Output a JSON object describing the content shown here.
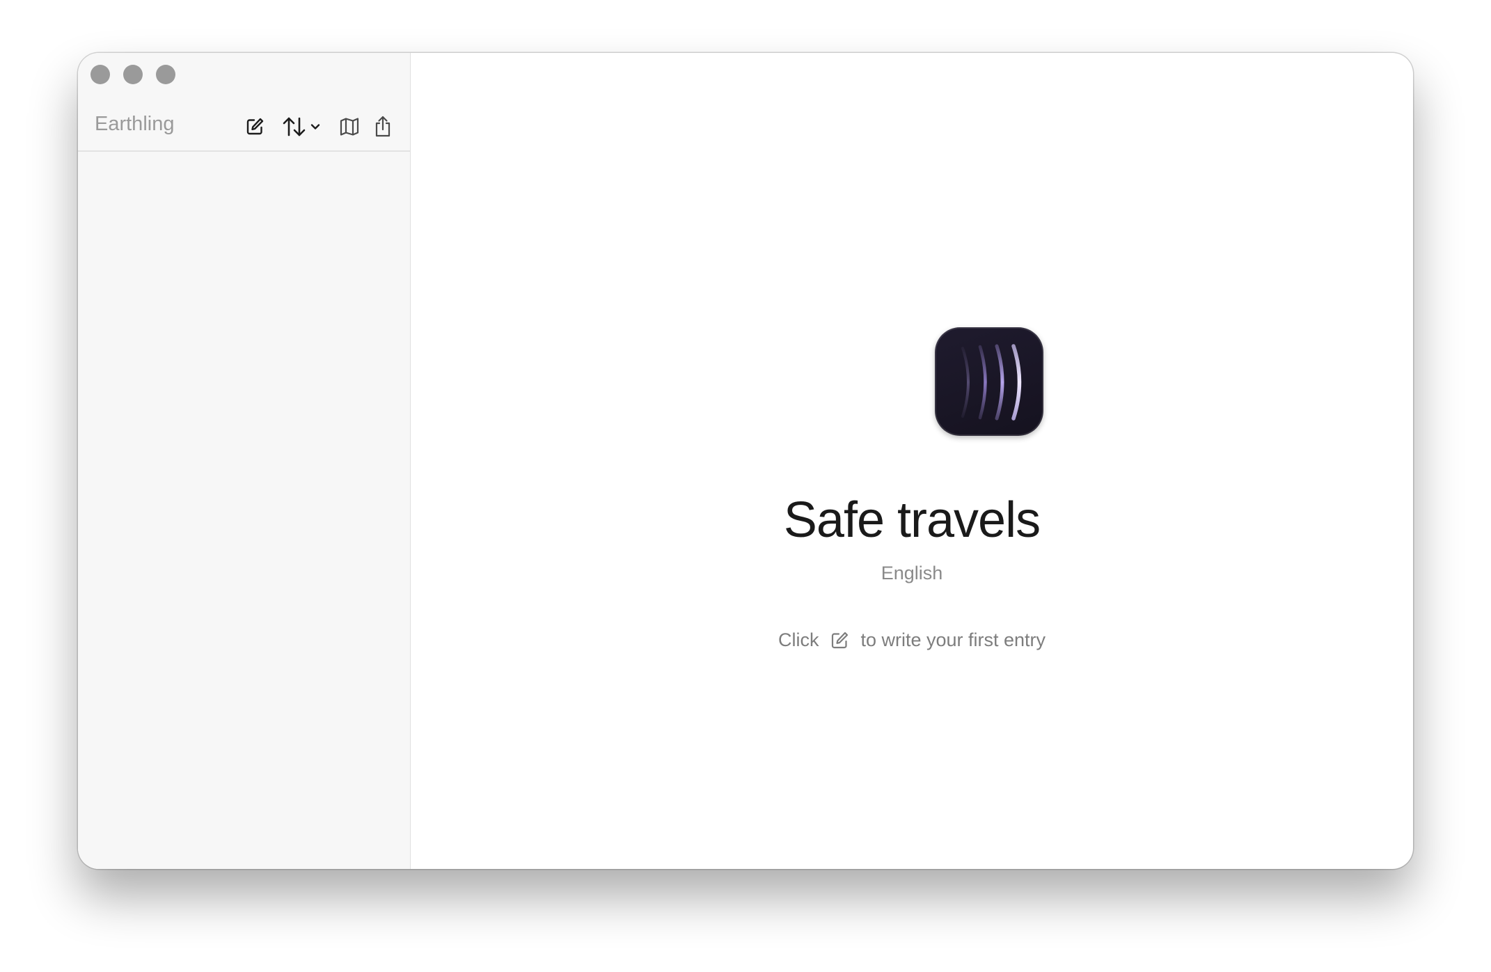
{
  "window": {
    "traffic_lights": [
      "close",
      "minimize",
      "zoom"
    ]
  },
  "sidebar": {
    "app_name": "Earthling",
    "toolbar": {
      "new_entry_icon": "compose-icon",
      "sort_icon": "sort-arrows-icon",
      "sort_dropdown_icon": "chevron-down-icon",
      "map_icon": "map-icon",
      "share_icon": "share-icon"
    }
  },
  "main": {
    "app_icon": "earthling-app-icon",
    "title": "Safe travels",
    "subtitle": "English",
    "hint_prefix": "Click",
    "hint_icon": "compose-icon",
    "hint_suffix": "to write your first entry"
  },
  "colors": {
    "sidebar_bg": "#f7f7f7",
    "traffic_light": "#9a9a9a",
    "icon_bg": "#18141f",
    "icon_stroke": "#b9a8ea"
  }
}
